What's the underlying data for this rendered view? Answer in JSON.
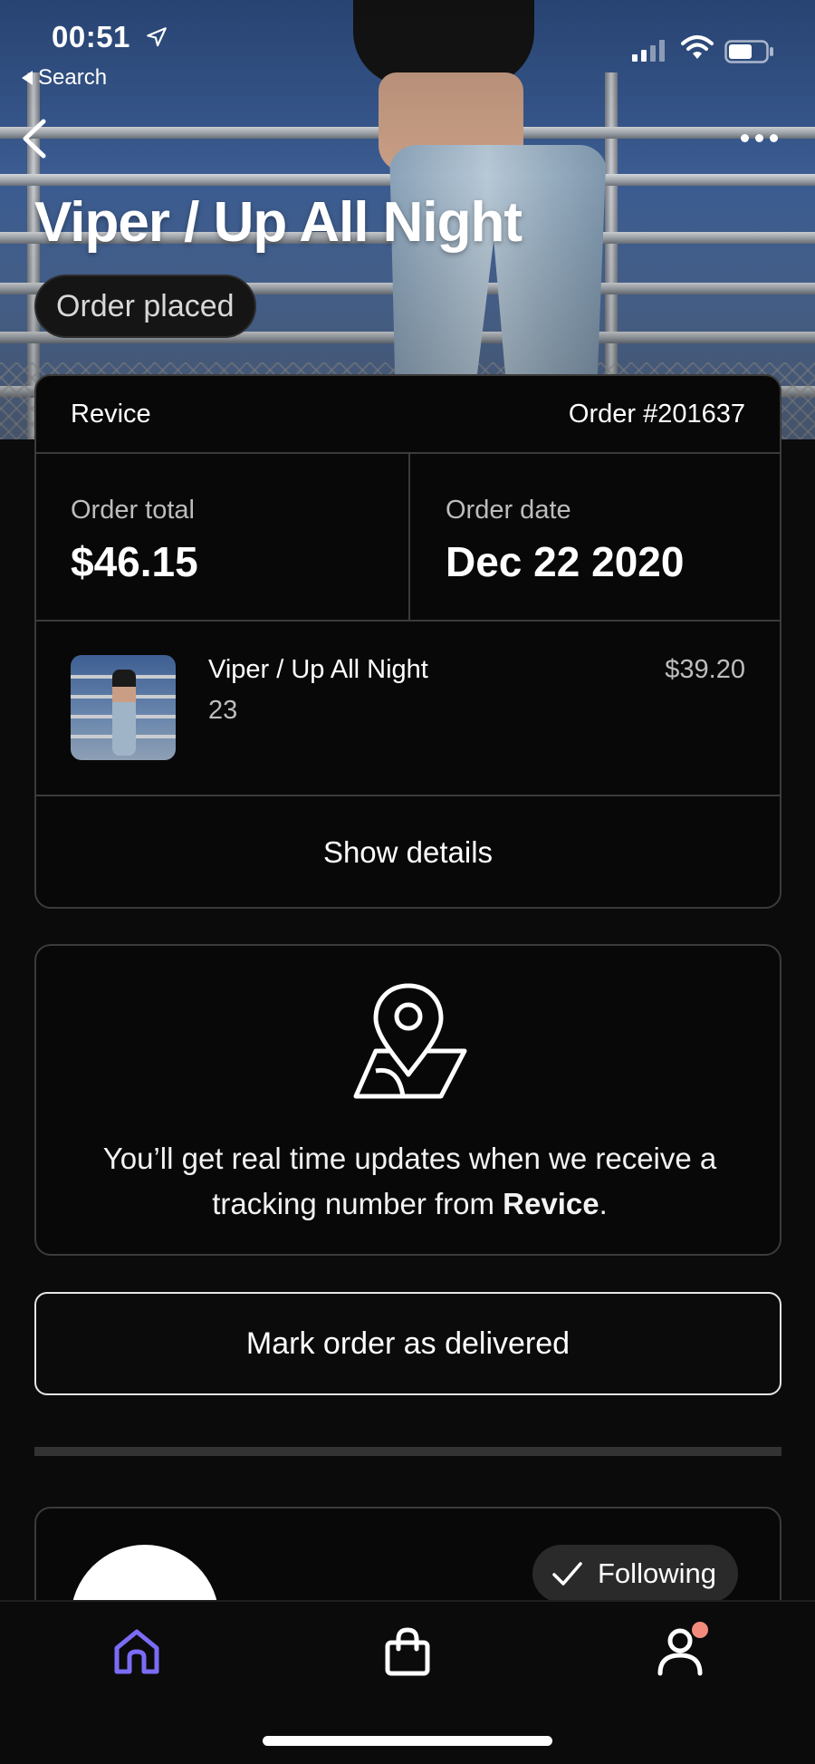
{
  "status_bar": {
    "time": "00:51",
    "back_to_app": "Search"
  },
  "header": {
    "title": "Viper / Up All Night",
    "status": "Order placed"
  },
  "order": {
    "store": "Revice",
    "number": "Order #201637",
    "total_label": "Order total",
    "total_value": "$46.15",
    "date_label": "Order date",
    "date_value": "Dec 22 2020",
    "item": {
      "name": "Viper / Up All Night",
      "size": "23",
      "price": "$39.20"
    },
    "show_details": "Show details"
  },
  "tracking": {
    "message_prefix": "You’ll get real time updates when we receive a tracking number from ",
    "store": "Revice",
    "message_suffix": "."
  },
  "actions": {
    "mark_delivered": "Mark order as delivered"
  },
  "store_card": {
    "following_label": "Following"
  },
  "tabbar": {
    "active_tab": "home",
    "accent_color": "#7b6cf6",
    "notification_color": "#f28b7c"
  }
}
